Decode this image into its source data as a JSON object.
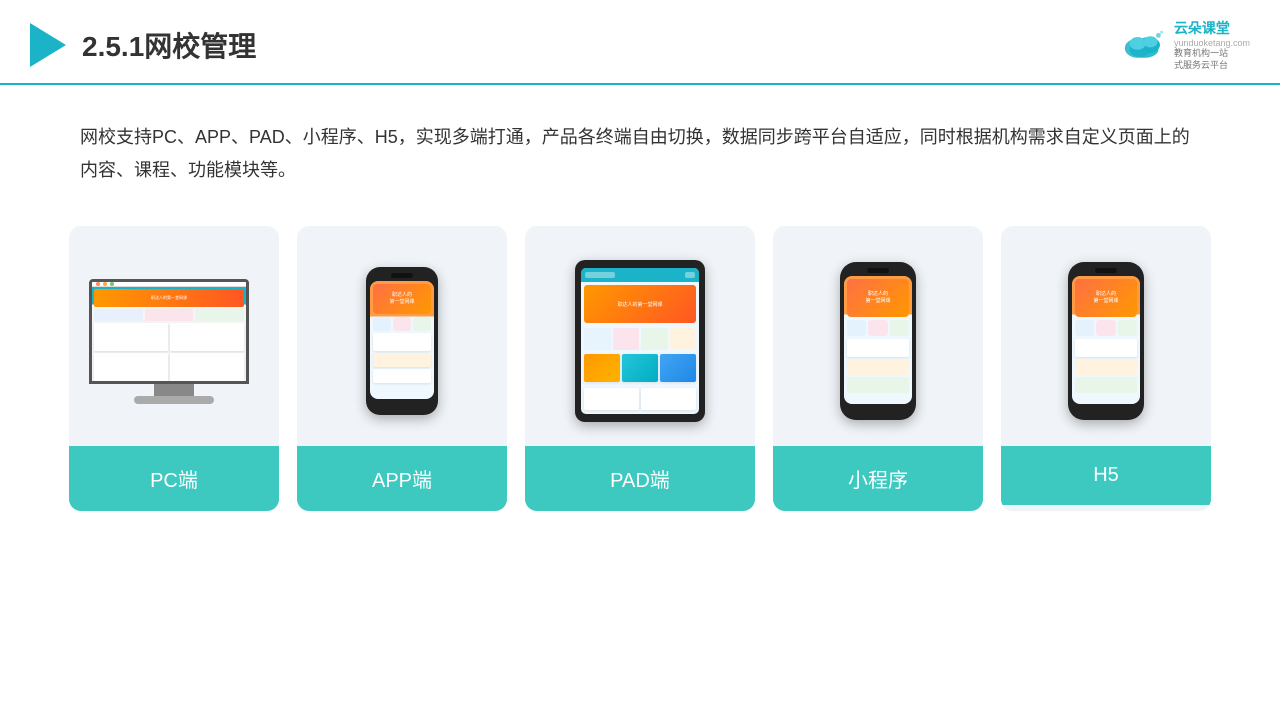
{
  "header": {
    "title": "2.5.1网校管理",
    "logo_brand": "云朵课堂",
    "logo_url": "yunduoketang.com",
    "logo_slogan": "教育机构一站\n式服务云平台"
  },
  "description": {
    "text": "网校支持PC、APP、PAD、小程序、H5，实现多端打通，产品各终端自由切换，数据同步跨平台自适应，同时根据机构需求自定义页面上的内容、课程、功能模块等。"
  },
  "cards": [
    {
      "id": "pc",
      "label": "PC端"
    },
    {
      "id": "app",
      "label": "APP端"
    },
    {
      "id": "pad",
      "label": "PAD端"
    },
    {
      "id": "miniprogram",
      "label": "小程序"
    },
    {
      "id": "h5",
      "label": "H5"
    }
  ],
  "colors": {
    "accent": "#1ab3c8",
    "teal": "#3dc8c0",
    "card_bg": "#edf2f7"
  }
}
